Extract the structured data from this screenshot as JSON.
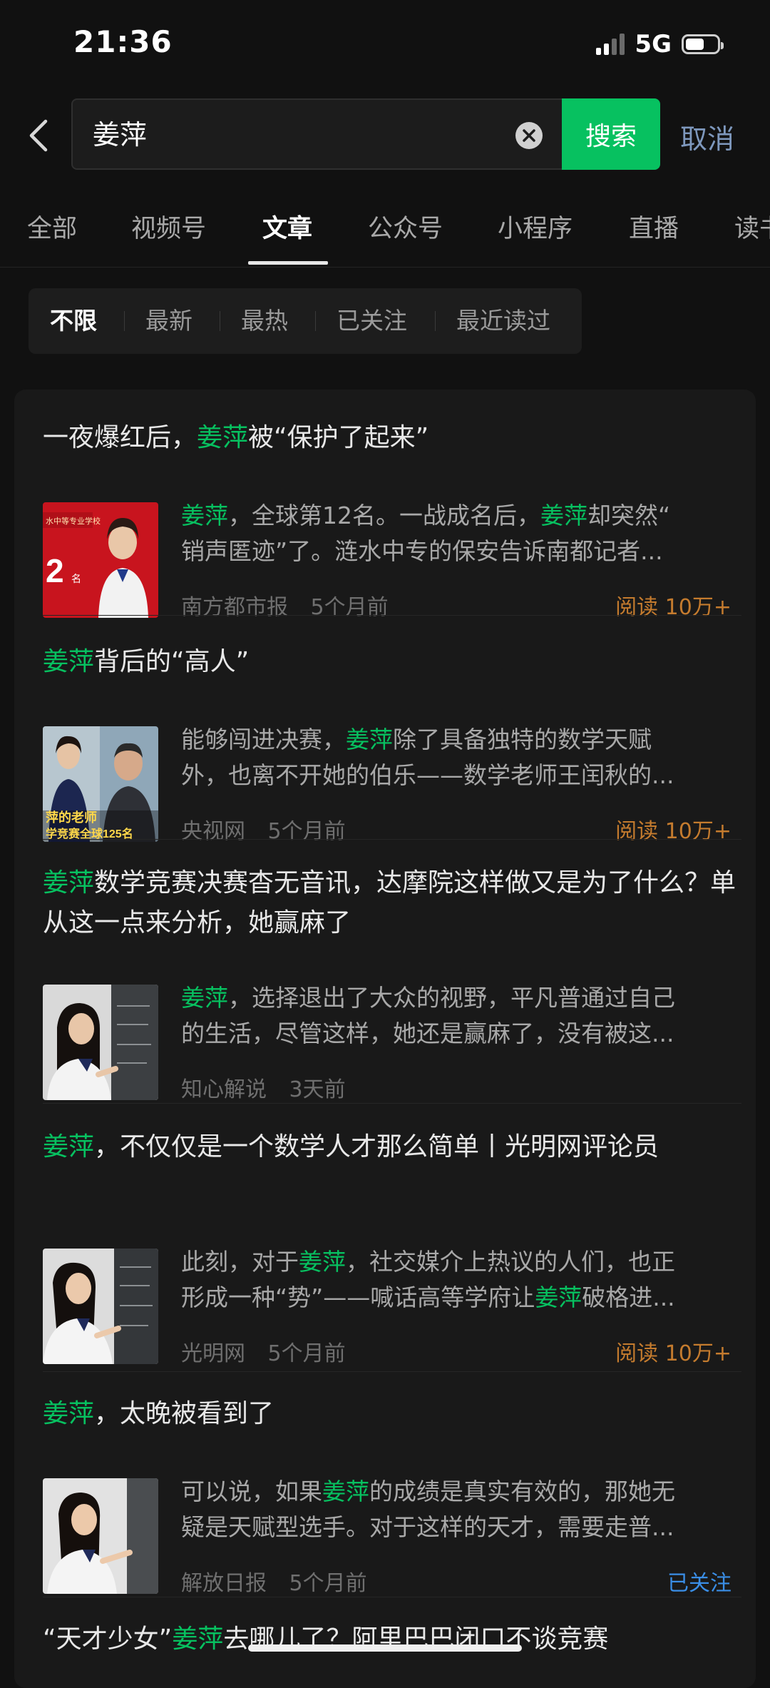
{
  "status": {
    "time": "21:36",
    "network": "5G",
    "battery_level": 0.6
  },
  "search": {
    "query": "姜萍",
    "search_button": "搜索",
    "cancel": "取消"
  },
  "tabs": [
    "全部",
    "视频号",
    "文章",
    "公众号",
    "小程序",
    "直播",
    "读书"
  ],
  "active_tab": "文章",
  "filters": [
    "不限",
    "最新",
    "最热",
    "已关注",
    "最近读过"
  ],
  "active_filter": "不限",
  "colors": {
    "accent_green": "#07c160",
    "read_count": "#c47b2e",
    "followed": "#3a8ee6",
    "cancel": "#7e98bd"
  },
  "results": [
    {
      "title": [
        {
          "t": "一夜爆红后，"
        },
        {
          "t": "姜萍",
          "h": true
        },
        {
          "t": "被“保护了起来”"
        }
      ],
      "snippet_lines": [
        [
          {
            "t": "姜萍",
            "h": true
          },
          {
            "t": "，全球第12名。一战成名后，"
          },
          {
            "t": "姜萍",
            "h": true
          },
          {
            "t": "却突然“"
          }
        ],
        [
          {
            "t": "销声匿迹”了。涟水中专的保安告诉南都记者..."
          }
        ]
      ],
      "source": "南方都市报",
      "time": "5个月前",
      "extra": "阅读 10万+",
      "extra_type": "reads",
      "thumb_icon": "photo-thumbnail-icon",
      "thumb_text": [
        "水中等专业学校",
        "2",
        "名"
      ]
    },
    {
      "title": [
        {
          "t": "姜萍",
          "h": true
        },
        {
          "t": "背后的“高人”"
        }
      ],
      "snippet_lines": [
        [
          {
            "t": "能够闯进决赛，"
          },
          {
            "t": "姜萍",
            "h": true
          },
          {
            "t": "除了具备独特的数学天赋"
          }
        ],
        [
          {
            "t": "外，也离不开她的伯乐——数学老师王闰秋的..."
          }
        ]
      ],
      "source": "央视网",
      "time": "5个月前",
      "extra": "阅读 10万+",
      "extra_type": "reads",
      "thumb_icon": "photo-thumbnail-icon",
      "thumb_text": [
        "萍的老师",
        "学竞赛全球125名"
      ]
    },
    {
      "title": [
        {
          "t": "姜萍",
          "h": true
        },
        {
          "t": "数学竞赛决赛杳无音讯，达摩院这样做又是为了什么？单从这一点来分析，她赢麻了"
        }
      ],
      "snippet_lines": [
        [
          {
            "t": "姜萍",
            "h": true
          },
          {
            "t": "，选择退出了大众的视野，平凡普通过自己"
          }
        ],
        [
          {
            "t": "的生活，尽管这样，她还是赢麻了，没有被这..."
          }
        ]
      ],
      "source": "知心解说",
      "time": "3天前",
      "extra": "",
      "extra_type": "none",
      "thumb_icon": "photo-thumbnail-icon",
      "thumb_text": []
    },
    {
      "title": [
        {
          "t": "姜萍",
          "h": true
        },
        {
          "t": "，不仅仅是一个数学人才那么简单丨光明网评论员"
        }
      ],
      "snippet_lines": [
        [
          {
            "t": "此刻，对于"
          },
          {
            "t": "姜萍",
            "h": true
          },
          {
            "t": "，社交媒介上热议的人们，也正"
          }
        ],
        [
          {
            "t": "形成一种“势”——喊话高等学府让"
          },
          {
            "t": "姜萍",
            "h": true
          },
          {
            "t": "破格进..."
          }
        ]
      ],
      "source": "光明网",
      "time": "5个月前",
      "extra": "阅读 10万+",
      "extra_type": "reads",
      "thumb_icon": "photo-thumbnail-icon",
      "thumb_text": []
    },
    {
      "title": [
        {
          "t": "姜萍",
          "h": true
        },
        {
          "t": "，太晚被看到了"
        }
      ],
      "snippet_lines": [
        [
          {
            "t": "可以说，如果"
          },
          {
            "t": "姜萍",
            "h": true
          },
          {
            "t": "的成绩是真实有效的，那她无"
          }
        ],
        [
          {
            "t": "疑是天赋型选手。对于这样的天才，需要走普..."
          }
        ]
      ],
      "source": "解放日报",
      "time": "5个月前",
      "extra": "已关注",
      "extra_type": "follow",
      "thumb_icon": "photo-thumbnail-icon",
      "thumb_text": []
    },
    {
      "title": [
        {
          "t": "“天才少女”"
        },
        {
          "t": "姜萍",
          "h": true
        },
        {
          "t": "去哪儿了？阿里巴巴闭口不谈竞赛"
        }
      ],
      "snippet_lines": [],
      "source": "",
      "time": "",
      "extra": "",
      "extra_type": "none",
      "thumb_icon": "",
      "thumb_text": []
    }
  ]
}
